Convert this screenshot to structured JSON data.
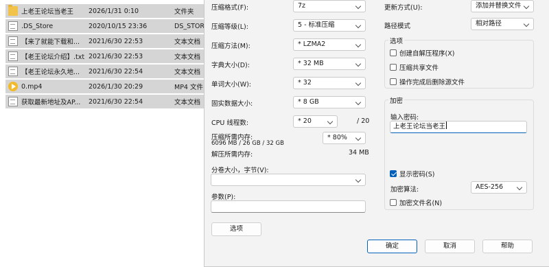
{
  "files": [
    {
      "icon": "folder",
      "name": "上老王论坛当老王",
      "date": "2026/1/31 0:10",
      "type": "文件夹"
    },
    {
      "icon": "doc",
      "name": ".DS_Store",
      "date": "2020/10/15 23:36",
      "type": "DS_STORE"
    },
    {
      "icon": "doc",
      "name": "【来了就能下载和...",
      "date": "2021/6/30 22:53",
      "type": "文本文档"
    },
    {
      "icon": "doc",
      "name": "【老王论坛介绍】.txt",
      "date": "2021/6/30 22:53",
      "type": "文本文档"
    },
    {
      "icon": "doc",
      "name": "【老王论坛永久地...",
      "date": "2021/6/30 22:54",
      "type": "文本文档"
    },
    {
      "icon": "media",
      "name": "0.mp4",
      "date": "2026/1/30 20:29",
      "type": "MP4 文件"
    },
    {
      "icon": "doc",
      "name": "获取最新地址及AP...",
      "date": "2021/6/30 22:54",
      "type": "文本文档"
    }
  ],
  "dialog": {
    "format_label": "压缩格式(F):",
    "format_value": "7z",
    "level_label": "压缩等级(L):",
    "level_value": "5 - 标准压缩",
    "method_label": "压缩方法(M):",
    "method_value": "* LZMA2",
    "dict_label": "字典大小(D):",
    "dict_value": "* 32 MB",
    "word_label": "单词大小(W):",
    "word_value": "* 32",
    "solid_label": "固实数据大小:",
    "solid_value": "* 8 GB",
    "threads_label": "CPU 线程数:",
    "threads_value": "* 20",
    "threads_max": "/ 20",
    "mem_label": "压缩所需内存:",
    "mem_detail": "6096 MB / 26 GB / 32 GB",
    "mem_percent": "* 80%",
    "decomp_label": "解压所需内存:",
    "decomp_value": "34 MB",
    "split_label": "分卷大小，字节(V):",
    "split_value": "",
    "params_label": "参数(P):",
    "params_value": "",
    "options_button": "选项",
    "update_label": "更新方式(U):",
    "update_value": "添加并替换文件",
    "path_label": "路径模式",
    "path_value": "相对路径",
    "options_group": "选项",
    "opt_sfx": "创建自解压程序(X)",
    "opt_shared": "压缩共享文件",
    "opt_delete": "操作完成后删除源文件",
    "enc_group": "加密",
    "pwd_label": "输入密码:",
    "pwd_value": "上老王论坛当老王",
    "show_pwd": "显示密码(S)",
    "enc_method_label": "加密算法:",
    "enc_method_value": "AES-256",
    "enc_names": "加密文件名(N)",
    "ok": "确定",
    "cancel": "取消",
    "help": "帮助"
  }
}
